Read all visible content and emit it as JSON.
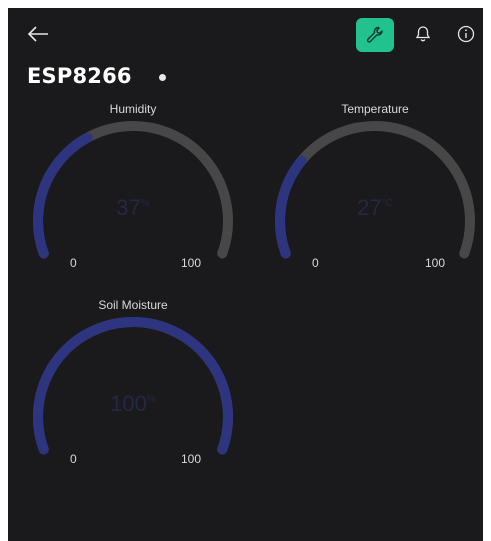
{
  "header": {
    "device_name": "ESP8266",
    "colors": {
      "accent": "#22c28f",
      "background": "#1a1a1c"
    },
    "icons": [
      "back-arrow-icon",
      "wrench-icon",
      "bell-icon",
      "info-icon"
    ]
  },
  "gauges": [
    {
      "title": "Humidity",
      "value": "37",
      "unit": "%",
      "min": "0",
      "max": "100",
      "fraction": 0.37,
      "color": "#2e3580"
    },
    {
      "title": "Temperature",
      "value": "27",
      "unit": "°C",
      "min": "0",
      "max": "100",
      "fraction": 0.27,
      "color": "#2e3580"
    },
    {
      "title": "Soil Moisture",
      "value": "100",
      "unit": "%",
      "min": "0",
      "max": "100",
      "fraction": 1.0,
      "color": "#2e3580"
    }
  ]
}
